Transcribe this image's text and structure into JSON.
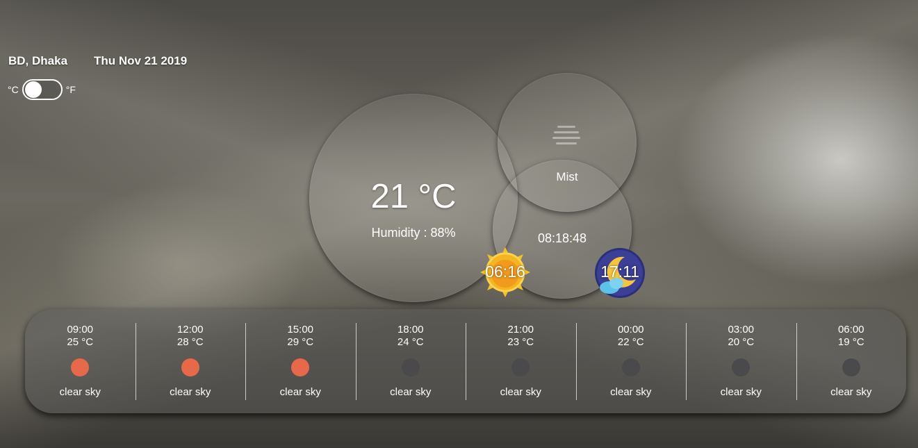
{
  "location": "BD, Dhaka",
  "date": "Thu Nov 21 2019",
  "units": {
    "celsius": "°C",
    "fahrenheit": "°F",
    "selected": "°C"
  },
  "current": {
    "temperature": "21 °C",
    "humidity": "Humidity : 88%",
    "description": "Mist",
    "icon": "mist-icon",
    "time": "08:18:48",
    "sunrise": "06:16",
    "sunset": "17:11"
  },
  "colors": {
    "day_dot": "#e8684a",
    "night_dot": "#4a4a4c"
  },
  "forecast": [
    {
      "time": "09:00",
      "temp": "25 °C",
      "desc": "clear sky",
      "icon": "sun-dot-icon"
    },
    {
      "time": "12:00",
      "temp": "28 °C",
      "desc": "clear sky",
      "icon": "sun-dot-icon"
    },
    {
      "time": "15:00",
      "temp": "29 °C",
      "desc": "clear sky",
      "icon": "sun-dot-icon"
    },
    {
      "time": "18:00",
      "temp": "24 °C",
      "desc": "clear sky",
      "icon": "moon-dot-icon"
    },
    {
      "time": "21:00",
      "temp": "23 °C",
      "desc": "clear sky",
      "icon": "moon-dot-icon"
    },
    {
      "time": "00:00",
      "temp": "22 °C",
      "desc": "clear sky",
      "icon": "moon-dot-icon"
    },
    {
      "time": "03:00",
      "temp": "20 °C",
      "desc": "clear sky",
      "icon": "moon-dot-icon"
    },
    {
      "time": "06:00",
      "temp": "19 °C",
      "desc": "clear sky",
      "icon": "moon-dot-icon"
    }
  ]
}
